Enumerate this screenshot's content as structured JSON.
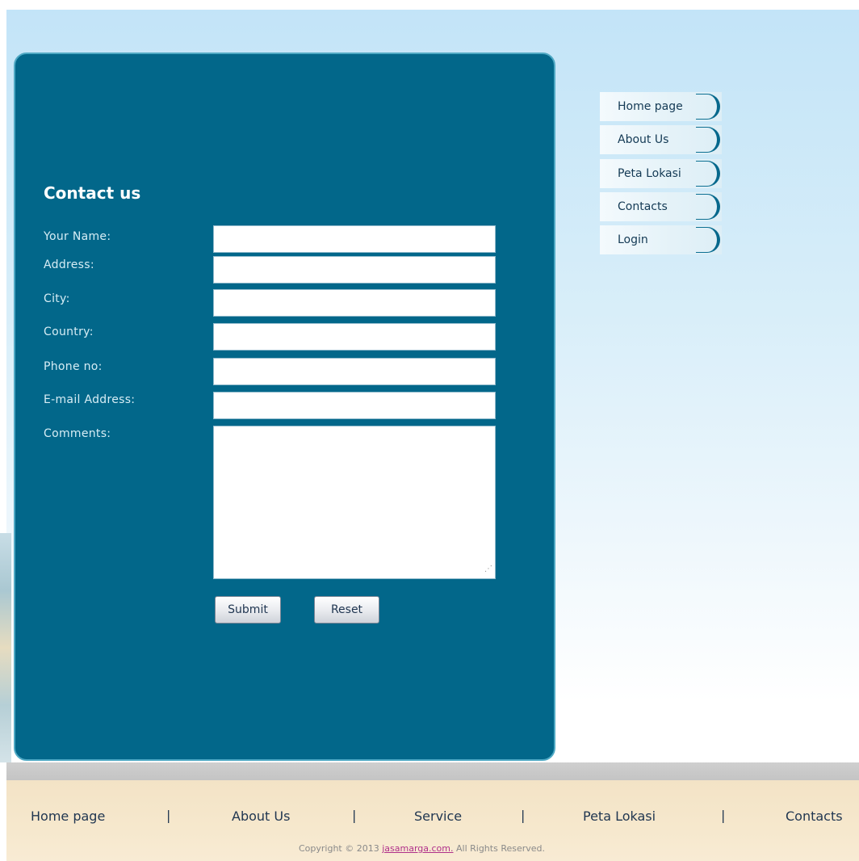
{
  "contact": {
    "title": "Contact us",
    "fields": {
      "name": {
        "label": "Your Name:",
        "value": ""
      },
      "address": {
        "label": "Address:",
        "value": ""
      },
      "city": {
        "label": "City:",
        "value": ""
      },
      "country": {
        "label": "Country:",
        "value": ""
      },
      "phone": {
        "label": "Phone no:",
        "value": ""
      },
      "email": {
        "label": "E-mail Address:",
        "value": ""
      },
      "comments": {
        "label": "Comments:",
        "value": ""
      }
    },
    "submit_label": "Submit",
    "reset_label": "Reset"
  },
  "side_nav": {
    "items": [
      {
        "label": "Home page"
      },
      {
        "label": "About Us"
      },
      {
        "label": "Peta Lokasi"
      },
      {
        "label": "Contacts"
      },
      {
        "label": "Login"
      }
    ]
  },
  "footer": {
    "links": [
      {
        "label": "Home page"
      },
      {
        "label": "About Us"
      },
      {
        "label": "Service"
      },
      {
        "label": "Peta Lokasi"
      },
      {
        "label": "Contacts"
      }
    ],
    "separator": "|",
    "copyright_prefix": "Copyright © 2013 ",
    "copyright_link": "jasamarga.com.",
    "copyright_suffix": " All Rights Reserved."
  },
  "colors": {
    "panel": "#02678a",
    "sky_top": "#c3e4f8",
    "footer_bg": "#f3e3c6",
    "link_accent": "#b0308a"
  }
}
